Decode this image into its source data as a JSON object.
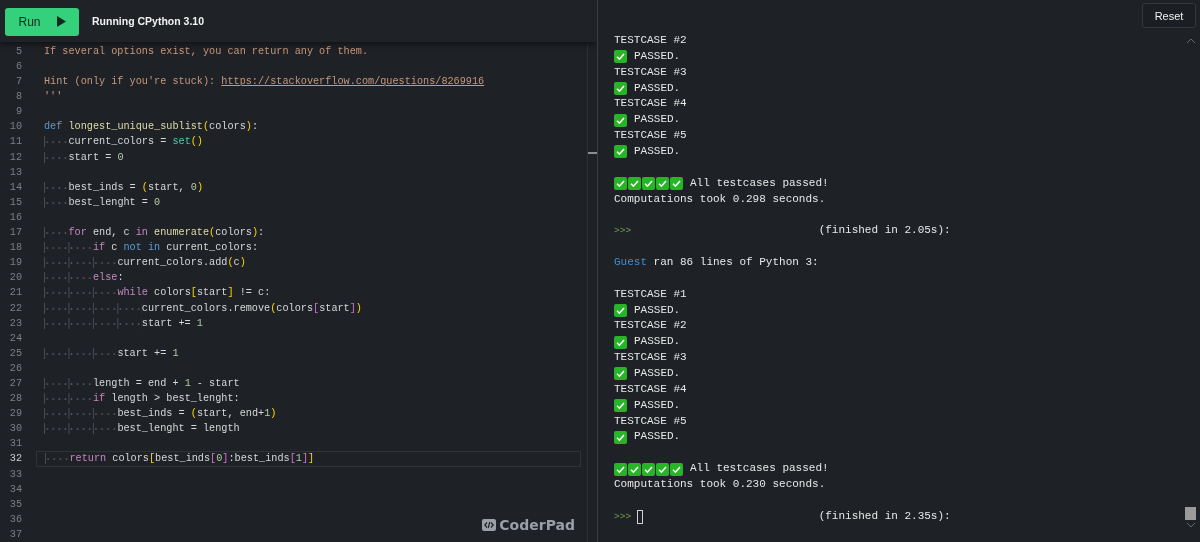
{
  "toolbar": {
    "run_button": "Run",
    "status": "Running CPython 3.10"
  },
  "editor": {
    "lines": [
      {
        "n": "5",
        "current": false,
        "tokens": [
          {
            "kind": "comment",
            "t": "If several options exist, you can return any of them."
          }
        ]
      },
      {
        "n": "6",
        "current": false
      },
      {
        "n": "7",
        "current": false,
        "tokens": [
          {
            "kind": "comment",
            "t": "Hint (only if you're stuck): "
          },
          {
            "kind": "link",
            "t": "https://stackoverflow.com/questions/8269916"
          }
        ]
      },
      {
        "n": "8",
        "current": false,
        "tokens": [
          {
            "kind": "comment",
            "t": "'''"
          }
        ]
      },
      {
        "n": "9",
        "current": false
      },
      {
        "n": "10",
        "current": false,
        "tokens": [
          {
            "kind": "def",
            "t": "def "
          },
          {
            "kind": "function",
            "t": "longest_unique_sublist"
          },
          {
            "kind": "bracket",
            "t": "("
          },
          {
            "kind": "plain",
            "t": "colors"
          },
          {
            "kind": "bracket",
            "t": ")"
          },
          {
            "kind": "plain",
            "t": ":"
          }
        ]
      },
      {
        "n": "11",
        "current": false,
        "tokens": [
          {
            "kind": "plain",
            "t": "    current_colors = "
          },
          {
            "kind": "builtin",
            "t": "set"
          },
          {
            "kind": "bracket",
            "t": "()"
          }
        ]
      },
      {
        "n": "12",
        "current": false,
        "tokens": [
          {
            "kind": "plain",
            "t": "    start = "
          },
          {
            "kind": "number",
            "t": "0"
          }
        ]
      },
      {
        "n": "13",
        "current": false
      },
      {
        "n": "14",
        "current": false,
        "tokens": [
          {
            "kind": "plain",
            "t": "    best_inds = "
          },
          {
            "kind": "bracket",
            "t": "("
          },
          {
            "kind": "plain",
            "t": "start, "
          },
          {
            "kind": "number",
            "t": "0"
          },
          {
            "kind": "bracket",
            "t": ")"
          }
        ]
      },
      {
        "n": "15",
        "current": false,
        "tokens": [
          {
            "kind": "plain",
            "t": "    best_lenght = "
          },
          {
            "kind": "number",
            "t": "0"
          }
        ]
      },
      {
        "n": "16",
        "current": false
      },
      {
        "n": "17",
        "current": false,
        "tokens": [
          {
            "kind": "keyword",
            "t": "    for"
          },
          {
            "kind": "plain",
            "t": " end, c "
          },
          {
            "kind": "keyword",
            "t": "in "
          },
          {
            "kind": "function",
            "t": "enumerate"
          },
          {
            "kind": "bracket",
            "t": "("
          },
          {
            "kind": "plain",
            "t": "colors"
          },
          {
            "kind": "bracket",
            "t": ")"
          },
          {
            "kind": "plain",
            "t": ":"
          }
        ]
      },
      {
        "n": "18",
        "current": false,
        "tokens": [
          {
            "kind": "keyword",
            "t": "        if"
          },
          {
            "kind": "plain",
            "t": " c "
          },
          {
            "kind": "def",
            "t": "not in"
          },
          {
            "kind": "plain",
            "t": " current_colors:"
          }
        ]
      },
      {
        "n": "19",
        "current": false,
        "tokens": [
          {
            "kind": "plain",
            "t": "            current_colors.add"
          },
          {
            "kind": "bracket",
            "t": "("
          },
          {
            "kind": "plain",
            "t": "c"
          },
          {
            "kind": "bracket",
            "t": ")"
          }
        ]
      },
      {
        "n": "20",
        "current": false,
        "tokens": [
          {
            "kind": "keyword",
            "t": "        else"
          },
          {
            "kind": "plain",
            "t": ":"
          }
        ]
      },
      {
        "n": "21",
        "current": false,
        "tokens": [
          {
            "kind": "keyword",
            "t": "            while"
          },
          {
            "kind": "plain",
            "t": " colors"
          },
          {
            "kind": "bracket",
            "t": "["
          },
          {
            "kind": "plain",
            "t": "start"
          },
          {
            "kind": "bracket",
            "t": "]"
          },
          {
            "kind": "plain",
            "t": " != c:"
          }
        ]
      },
      {
        "n": "22",
        "current": false,
        "tokens": [
          {
            "kind": "plain",
            "t": "                current_colors.remove"
          },
          {
            "kind": "bracket",
            "t": "("
          },
          {
            "kind": "plain",
            "t": "colors"
          },
          {
            "kind": "bracket2",
            "t": "["
          },
          {
            "kind": "plain",
            "t": "start"
          },
          {
            "kind": "bracket2",
            "t": "]"
          },
          {
            "kind": "bracket",
            "t": ")"
          }
        ]
      },
      {
        "n": "23",
        "current": false,
        "tokens": [
          {
            "kind": "plain",
            "t": "                start += "
          },
          {
            "kind": "number",
            "t": "1"
          }
        ]
      },
      {
        "n": "24",
        "current": false
      },
      {
        "n": "25",
        "current": false,
        "tokens": [
          {
            "kind": "plain",
            "t": "            start += "
          },
          {
            "kind": "number",
            "t": "1"
          }
        ]
      },
      {
        "n": "26",
        "current": false
      },
      {
        "n": "27",
        "current": false,
        "tokens": [
          {
            "kind": "plain",
            "t": "        length = end + "
          },
          {
            "kind": "number",
            "t": "1"
          },
          {
            "kind": "plain",
            "t": " - start"
          }
        ]
      },
      {
        "n": "28",
        "current": false,
        "tokens": [
          {
            "kind": "keyword",
            "t": "        if"
          },
          {
            "kind": "plain",
            "t": " length > best_lenght:"
          }
        ]
      },
      {
        "n": "29",
        "current": false,
        "tokens": [
          {
            "kind": "plain",
            "t": "            best_inds = "
          },
          {
            "kind": "bracket",
            "t": "("
          },
          {
            "kind": "plain",
            "t": "start, end+"
          },
          {
            "kind": "number",
            "t": "1"
          },
          {
            "kind": "bracket",
            "t": ")"
          }
        ]
      },
      {
        "n": "30",
        "current": false,
        "tokens": [
          {
            "kind": "plain",
            "t": "            best_lenght = length"
          }
        ]
      },
      {
        "n": "31",
        "current": false
      },
      {
        "n": "32",
        "current": true,
        "tokens": [
          {
            "kind": "keyword",
            "t": "    return"
          },
          {
            "kind": "plain",
            "t": " colors"
          },
          {
            "kind": "bracket",
            "t": "["
          },
          {
            "kind": "plain",
            "t": "best_inds"
          },
          {
            "kind": "bracket2",
            "t": "["
          },
          {
            "kind": "number",
            "t": "0"
          },
          {
            "kind": "bracket2",
            "t": "]"
          },
          {
            "kind": "plain",
            "t": ":best_inds"
          },
          {
            "kind": "bracket2",
            "t": "["
          },
          {
            "kind": "number",
            "t": "1"
          },
          {
            "kind": "bracket2",
            "t": "]"
          },
          {
            "kind": "bracket",
            "t": "]"
          }
        ]
      },
      {
        "n": "33",
        "current": false
      },
      {
        "n": "34",
        "current": false
      },
      {
        "n": "35",
        "current": false
      },
      {
        "n": "36",
        "current": false
      },
      {
        "n": "37",
        "current": false
      }
    ],
    "brand": "CoderPad"
  },
  "console": {
    "reset_button": "Reset",
    "lines": [
      {
        "kind": "text",
        "text": "TESTCASE #2"
      },
      {
        "kind": "result",
        "passed": true,
        "text": "PASSED."
      },
      {
        "kind": "text",
        "text": "TESTCASE #3"
      },
      {
        "kind": "result",
        "passed": true,
        "text": "PASSED."
      },
      {
        "kind": "text",
        "text": "TESTCASE #4"
      },
      {
        "kind": "result",
        "passed": true,
        "text": "PASSED."
      },
      {
        "kind": "text",
        "text": "TESTCASE #5"
      },
      {
        "kind": "result",
        "passed": true,
        "text": "PASSED."
      },
      {
        "kind": "blank"
      },
      {
        "kind": "summary",
        "results": [
          {
            "passed": true
          },
          {
            "passed": true
          },
          {
            "passed": true
          },
          {
            "passed": true
          },
          {
            "passed": true
          }
        ],
        "text": "All testcases passed!"
      },
      {
        "kind": "text",
        "text": "Computations took 0.298 seconds."
      },
      {
        "kind": "blank"
      },
      {
        "kind": "prompt",
        "prompt": ">>>",
        "cursor": false,
        "text": "(finished in 2.05s):"
      },
      {
        "kind": "blank"
      },
      {
        "kind": "info",
        "user": "Guest",
        "text": "ran 86 lines of Python 3:"
      },
      {
        "kind": "blank"
      },
      {
        "kind": "text",
        "text": "TESTCASE #1"
      },
      {
        "kind": "result",
        "passed": true,
        "text": "PASSED."
      },
      {
        "kind": "text",
        "text": "TESTCASE #2"
      },
      {
        "kind": "result",
        "passed": true,
        "text": "PASSED."
      },
      {
        "kind": "text",
        "text": "TESTCASE #3"
      },
      {
        "kind": "result",
        "passed": true,
        "text": "PASSED."
      },
      {
        "kind": "text",
        "text": "TESTCASE #4"
      },
      {
        "kind": "result",
        "passed": true,
        "text": "PASSED."
      },
      {
        "kind": "text",
        "text": "TESTCASE #5"
      },
      {
        "kind": "result",
        "passed": true,
        "text": "PASSED."
      },
      {
        "kind": "blank"
      },
      {
        "kind": "summary",
        "results": [
          {
            "passed": true
          },
          {
            "passed": true
          },
          {
            "passed": true
          },
          {
            "passed": true
          },
          {
            "passed": true
          }
        ],
        "text": "All testcases passed!"
      },
      {
        "kind": "text",
        "text": "Computations took 0.230 seconds."
      },
      {
        "kind": "blank"
      },
      {
        "kind": "prompt",
        "prompt": ">>>",
        "cursor": true,
        "text": "(finished in 2.35s):"
      }
    ]
  }
}
